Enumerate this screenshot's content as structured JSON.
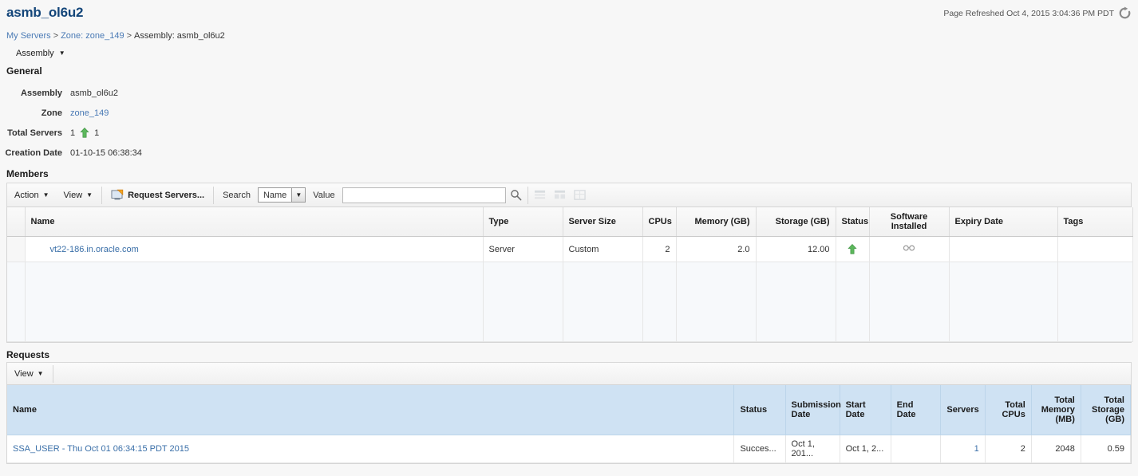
{
  "header": {
    "title": "asmb_ol6u2",
    "refreshed_label": "Page Refreshed Oct 4, 2015 3:04:36 PM PDT",
    "refresh_icon": "refresh-icon"
  },
  "breadcrumb": {
    "items": [
      {
        "label": "My Servers",
        "link": true
      },
      {
        "label": "Zone: zone_149",
        "link": true
      },
      {
        "label": "Assembly: asmb_ol6u2",
        "link": false
      }
    ],
    "separator": ">"
  },
  "assembly_menu": {
    "label": "Assembly",
    "caret": "▼"
  },
  "general": {
    "section_title": "General",
    "rows": [
      {
        "label": "Assembly",
        "value": "asmb_ol6u2",
        "link": false
      },
      {
        "label": "Zone",
        "value": "zone_149",
        "link": true
      },
      {
        "label": "Total Servers",
        "value": "1",
        "value2": "1",
        "icon": "green-up-arrow-icon"
      },
      {
        "label": "Creation Date",
        "value": "01-10-15 06:38:34",
        "link": false
      }
    ]
  },
  "members": {
    "section_title": "Members",
    "toolbar": {
      "action_label": "Action",
      "view_label": "View",
      "request_servers_label": "Request Servers...",
      "request_servers_icon": "request-servers-icon",
      "search_label": "Search",
      "search_field_selected": "Name",
      "value_label": "Value",
      "value_input": "",
      "value_placeholder": "",
      "search_icon": "search-icon",
      "disabled_icons": [
        "detach-icon",
        "freeze-icon",
        "wrap-icon"
      ],
      "caret": "▼"
    },
    "columns": [
      "Name",
      "Type",
      "Server Size",
      "CPUs",
      "Memory (GB)",
      "Storage (GB)",
      "Status",
      "Software Installed",
      "Expiry Date",
      "Tags"
    ],
    "rows": [
      {
        "name": "vt22-186.in.oracle.com",
        "type": "Server",
        "server_size": "Custom",
        "cpus": "2",
        "memory_gb": "2.0",
        "storage_gb": "12.00",
        "status_icon": "green-up-arrow-icon",
        "software_installed_icon": "glasses-icon",
        "expiry_date": "",
        "tags": ""
      }
    ]
  },
  "requests": {
    "section_title": "Requests",
    "toolbar": {
      "view_label": "View",
      "caret": "▼"
    },
    "columns": [
      "Name",
      "Status",
      "Submission Date",
      "Start Date",
      "End Date",
      "Servers",
      "Total CPUs",
      "Total Memory (MB)",
      "Total Storage (GB)"
    ],
    "rows": [
      {
        "name": "SSA_USER - Thu Oct 01 06:34:15 PDT 2015",
        "status": "Succes...",
        "submission_date": "Oct 1, 201...",
        "start_date": "Oct 1, 2...",
        "end_date": "",
        "servers": "1",
        "total_cpus": "2",
        "total_memory_mb": "2048",
        "total_storage_gb": "0.59"
      }
    ]
  },
  "colors": {
    "title_blue": "#14467a",
    "link_blue": "#4a7ab5",
    "status_green": "#4caf50",
    "header_blue_bg": "#cfe2f3"
  }
}
